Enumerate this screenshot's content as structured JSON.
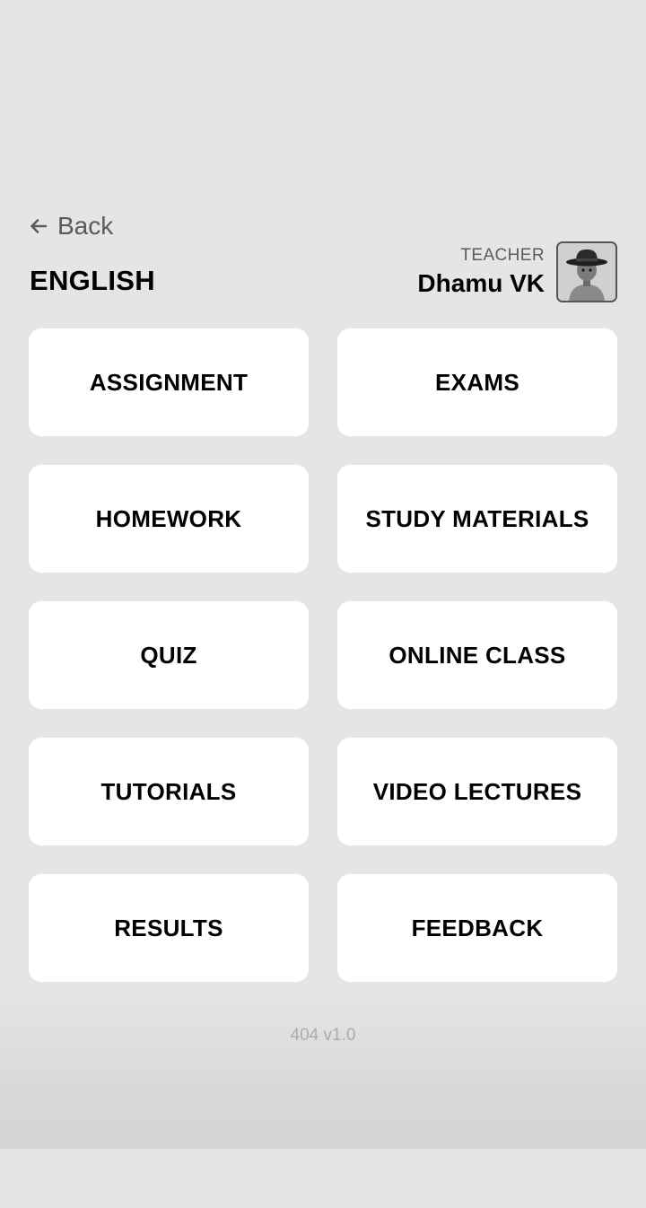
{
  "nav": {
    "back_label": "Back",
    "back_icon": "arrow-left-icon"
  },
  "header": {
    "subject": "ENGLISH",
    "teacher_role": "TEACHER",
    "teacher_name": "Dhamu VK",
    "avatar_icon": "teacher-avatar"
  },
  "menu": [
    {
      "label": "ASSIGNMENT"
    },
    {
      "label": "EXAMS"
    },
    {
      "label": "HOMEWORK"
    },
    {
      "label": "STUDY MATERIALS"
    },
    {
      "label": "QUIZ"
    },
    {
      "label": "ONLINE CLASS"
    },
    {
      "label": "TUTORIALS"
    },
    {
      "label": "VIDEO LECTURES"
    },
    {
      "label": "RESULTS"
    },
    {
      "label": "FEEDBACK"
    }
  ],
  "footer": {
    "version": "404 v1.0"
  }
}
